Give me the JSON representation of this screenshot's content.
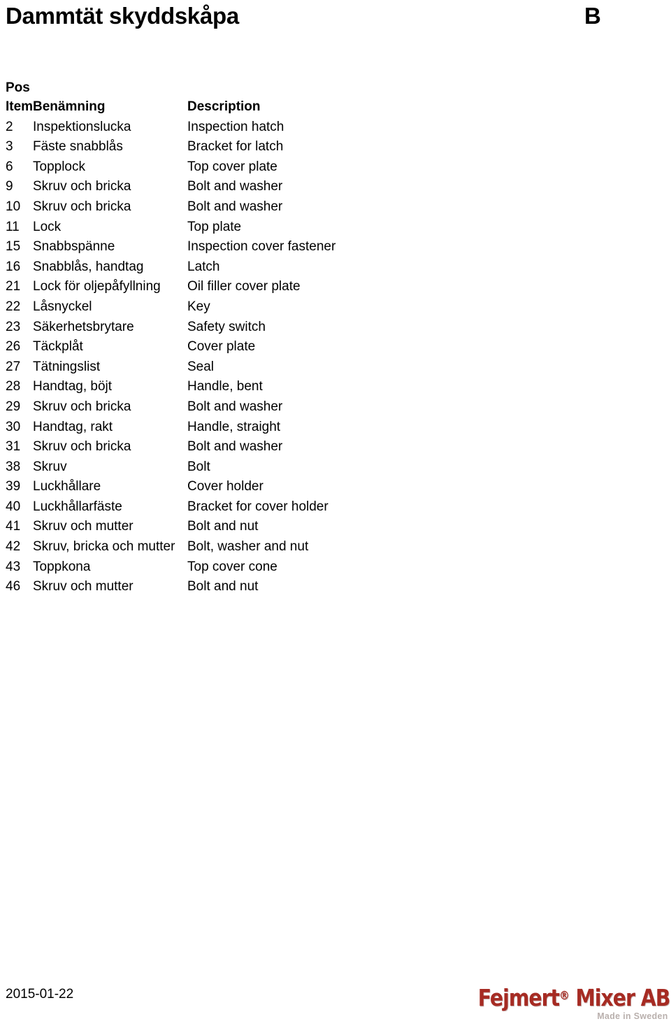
{
  "header": {
    "title": "Dammtät skyddskåpa",
    "section_letter": "B"
  },
  "table": {
    "headers": {
      "pos": "Pos",
      "item": "Item",
      "name": "Benämning",
      "description": "Description"
    },
    "rows": [
      {
        "item": "2",
        "name": "Inspektionslucka",
        "description": "Inspection hatch"
      },
      {
        "item": "3",
        "name": "Fäste snabblås",
        "description": "Bracket for latch"
      },
      {
        "item": "6",
        "name": "Topplock",
        "description": "Top cover plate"
      },
      {
        "item": "9",
        "name": "Skruv och bricka",
        "description": "Bolt and washer"
      },
      {
        "item": "10",
        "name": "Skruv och bricka",
        "description": "Bolt and washer"
      },
      {
        "item": "11",
        "name": "Lock",
        "description": "Top plate"
      },
      {
        "item": "15",
        "name": "Snabbspänne",
        "description": "Inspection cover fastener"
      },
      {
        "item": "16",
        "name": "Snabblås, handtag",
        "description": "Latch"
      },
      {
        "item": "21",
        "name": "Lock för oljepåfyllning",
        "description": "Oil filler cover plate"
      },
      {
        "item": "22",
        "name": "Låsnyckel",
        "description": "Key"
      },
      {
        "item": "23",
        "name": "Säkerhetsbrytare",
        "description": "Safety switch"
      },
      {
        "item": "26",
        "name": "Täckplåt",
        "description": "Cover plate"
      },
      {
        "item": "27",
        "name": "Tätningslist",
        "description": "Seal"
      },
      {
        "item": "28",
        "name": "Handtag, böjt",
        "description": "Handle, bent"
      },
      {
        "item": "29",
        "name": "Skruv och bricka",
        "description": "Bolt and washer"
      },
      {
        "item": "30",
        "name": "Handtag, rakt",
        "description": "Handle, straight"
      },
      {
        "item": "31",
        "name": "Skruv och bricka",
        "description": "Bolt and washer"
      },
      {
        "item": "38",
        "name": "Skruv",
        "description": "Bolt"
      },
      {
        "item": "39",
        "name": "Luckhållare",
        "description": "Cover holder"
      },
      {
        "item": "40",
        "name": "Luckhållarfäste",
        "description": "Bracket for cover holder"
      },
      {
        "item": "41",
        "name": "Skruv och mutter",
        "description": "Bolt and nut"
      },
      {
        "item": "42",
        "name": "Skruv, bricka och mutter",
        "description": "Bolt, washer and nut"
      },
      {
        "item": "43",
        "name": "Toppkona",
        "description": "Top cover cone"
      },
      {
        "item": "46",
        "name": "Skruv och mutter",
        "description": "Bolt and nut"
      }
    ]
  },
  "footer": {
    "date": "2015-01-22",
    "logo": {
      "brand": "Fejmert",
      "registered_mark": "®",
      "brand_suffix": " Mixer AB",
      "tagline": "Made in Sweden",
      "color": "#A62B23",
      "tagline_color": "#b9b0ad"
    }
  }
}
